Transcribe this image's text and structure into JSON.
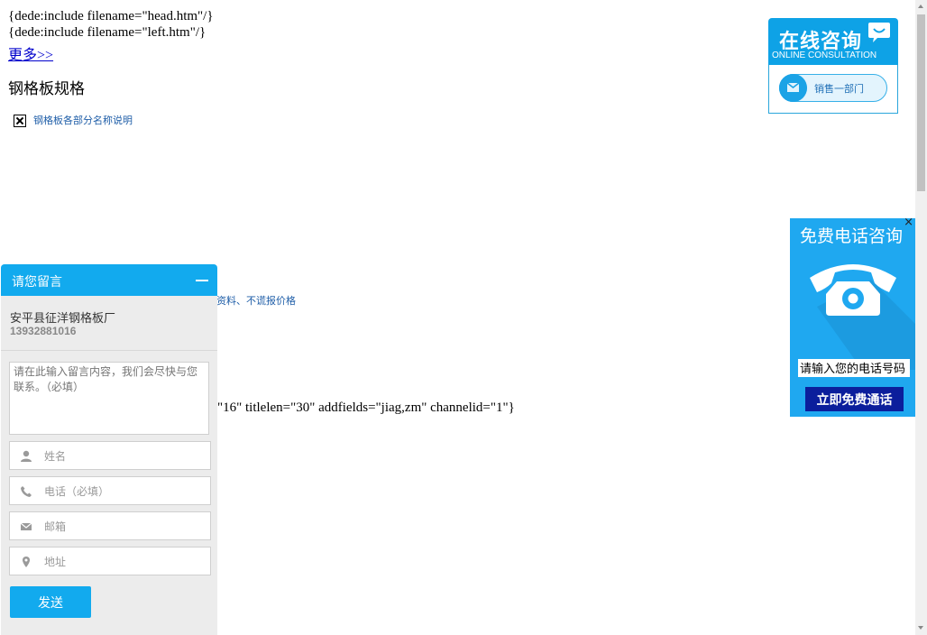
{
  "page": {
    "include_head": "{dede:include filename=\"head.htm\"/}",
    "include_left": "{dede:include filename=\"left.htm\"/}",
    "more_link": "更多>>",
    "heading": "钢格板规格",
    "image_alt": "钢格板各部分名称说明",
    "info_link": "资料、不谎报价格",
    "template_tail": "\"16\" titlelen=\"30\" addfields=\"jiag,zm\" channelid=\"1\"}"
  },
  "message_widget": {
    "title": "请您留言",
    "company_name": "安平县征洋钢格板厂",
    "company_phone": "13932881016",
    "content_placeholder": "请在此输入留言内容，我们会尽快与您联系。（必填）",
    "name_placeholder": "姓名",
    "phone_placeholder": "电话（必填）",
    "email_placeholder": "邮箱",
    "address_placeholder": "地址",
    "send_label": "发送",
    "icons": [
      "user-icon",
      "phone-icon",
      "mail-icon",
      "location-pin-icon"
    ],
    "accent_color": "#12aaee"
  },
  "consult_panel": {
    "title": "在线咨询",
    "subtitle": "ONLINE CONSULTATION",
    "sales_label": "销售一部门",
    "accent_color": "#0ea2e6"
  },
  "call_panel": {
    "title": "免费电话咨询",
    "phone_placeholder": "请输入您的电话号码",
    "submit_label": "立即免费通话",
    "close_label": "×",
    "background_color": "#1fa8f0",
    "button_color": "#0b1e9c"
  }
}
